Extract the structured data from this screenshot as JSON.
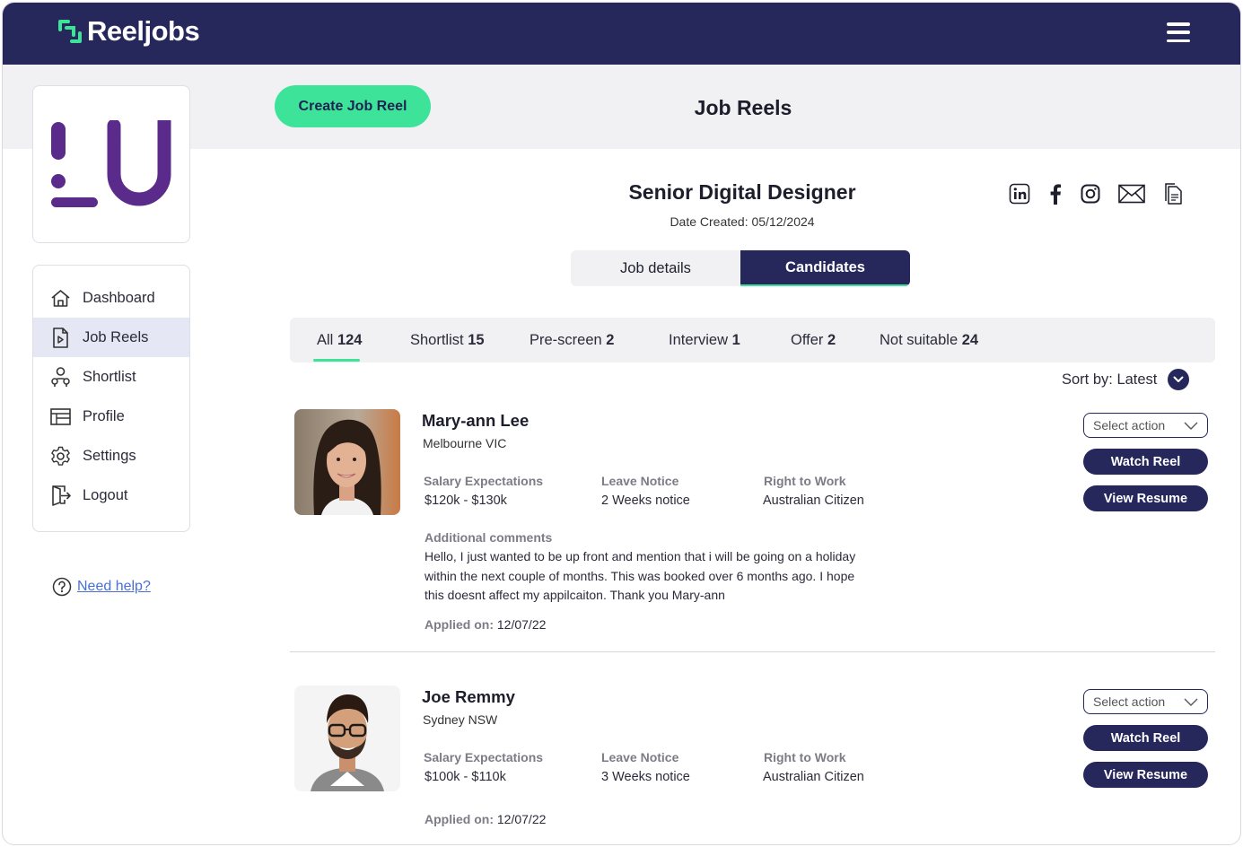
{
  "brand": {
    "name": "Reeljobs",
    "accent": "#3ee39a",
    "navy": "#26275b",
    "purple": "#5b2b8c"
  },
  "header": {
    "menu_icon": "hamburger-icon"
  },
  "sidebar": {
    "items": [
      {
        "label": "Dashboard",
        "icon": "home-icon"
      },
      {
        "label": "Job Reels",
        "icon": "play-document-icon",
        "active": true
      },
      {
        "label": "Shortlist",
        "icon": "people-icon"
      },
      {
        "label": "Profile",
        "icon": "profile-table-icon"
      },
      {
        "label": "Settings",
        "icon": "gear-icon"
      },
      {
        "label": "Logout",
        "icon": "logout-icon"
      }
    ],
    "help_label": "Need help?"
  },
  "actions": {
    "create_label": "Create Job Reel"
  },
  "page": {
    "title": "Job Reels"
  },
  "job": {
    "title": "Senior Digital Designer",
    "date_created": "Date Created: 05/12/2024",
    "share_icons": [
      "linkedin-icon",
      "facebook-icon",
      "instagram-icon",
      "mail-icon",
      "copy-document-icon"
    ]
  },
  "tabs": {
    "job_details": "Job details",
    "candidates": "Candidates"
  },
  "filters": [
    {
      "label": "All",
      "count": "124",
      "active": true
    },
    {
      "label": "Shortlist",
      "count": "15"
    },
    {
      "label": "Pre-screen",
      "count": "2"
    },
    {
      "label": "Interview",
      "count": "1"
    },
    {
      "label": "Offer",
      "count": "2"
    },
    {
      "label": "Not suitable",
      "count": "24"
    }
  ],
  "sort": {
    "label": "Sort by: Latest"
  },
  "labels": {
    "salary": "Salary Expectations",
    "notice": "Leave Notice",
    "rtw": "Right to Work",
    "comments": "Additional comments",
    "applied": "Applied on:",
    "select_action": "Select action",
    "watch_reel": "Watch Reel",
    "view_resume": "View Resume"
  },
  "candidates": [
    {
      "name": "Mary-ann Lee",
      "location": "Melbourne VIC",
      "salary": "$120k - $130k",
      "notice": "2 Weeks notice",
      "rtw": "Australian Citizen",
      "comment": "Hello, I just wanted to be up front and mention that i will be going on a holiday within the next couple of months. This was booked over 6 months ago. I hope this doesnt affect my appilcaiton. Thank you Mary-ann",
      "applied": "12/07/22"
    },
    {
      "name": "Joe Remmy",
      "location": "Sydney NSW",
      "salary": "$100k - $110k",
      "notice": "3 Weeks notice",
      "rtw": "Australian Citizen",
      "applied": "12/07/22"
    }
  ]
}
